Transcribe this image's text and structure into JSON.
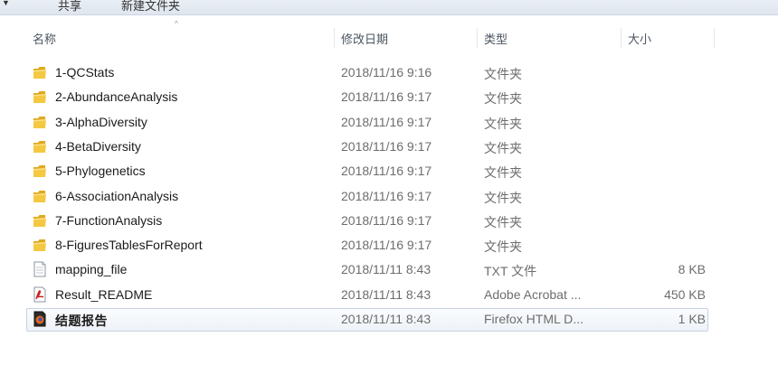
{
  "toolbar": {
    "share_label": "共享",
    "new_folder_label": "新建文件夹"
  },
  "columns": {
    "name": "名称",
    "modified": "修改日期",
    "type": "类型",
    "size": "大小"
  },
  "files": [
    {
      "name": "1-QCStats",
      "modified": "2018/11/16 9:16",
      "type": "文件夹",
      "size": "",
      "icon": "folder-icon"
    },
    {
      "name": "2-AbundanceAnalysis",
      "modified": "2018/11/16 9:17",
      "type": "文件夹",
      "size": "",
      "icon": "folder-icon"
    },
    {
      "name": "3-AlphaDiversity",
      "modified": "2018/11/16 9:17",
      "type": "文件夹",
      "size": "",
      "icon": "folder-icon"
    },
    {
      "name": "4-BetaDiversity",
      "modified": "2018/11/16 9:17",
      "type": "文件夹",
      "size": "",
      "icon": "folder-icon"
    },
    {
      "name": "5-Phylogenetics",
      "modified": "2018/11/16 9:17",
      "type": "文件夹",
      "size": "",
      "icon": "folder-icon"
    },
    {
      "name": "6-AssociationAnalysis",
      "modified": "2018/11/16 9:17",
      "type": "文件夹",
      "size": "",
      "icon": "folder-icon"
    },
    {
      "name": "7-FunctionAnalysis",
      "modified": "2018/11/16 9:17",
      "type": "文件夹",
      "size": "",
      "icon": "folder-icon"
    },
    {
      "name": "8-FiguresTablesForReport",
      "modified": "2018/11/16 9:17",
      "type": "文件夹",
      "size": "",
      "icon": "folder-icon"
    },
    {
      "name": "mapping_file",
      "modified": "2018/11/11 8:43",
      "type": "TXT 文件",
      "size": "8 KB",
      "icon": "text-file-icon"
    },
    {
      "name": "Result_README",
      "modified": "2018/11/11 8:43",
      "type": "Adobe Acrobat ...",
      "size": "450 KB",
      "icon": "pdf-file-icon"
    },
    {
      "name": "结题报告",
      "modified": "2018/11/11 8:43",
      "type": "Firefox HTML D...",
      "size": "1 KB",
      "icon": "html-file-icon",
      "selected": true
    }
  ],
  "colors": {
    "folder": "#f0c23b",
    "selection_border": "#c7d3e0",
    "pdf_red": "#c8201e"
  }
}
